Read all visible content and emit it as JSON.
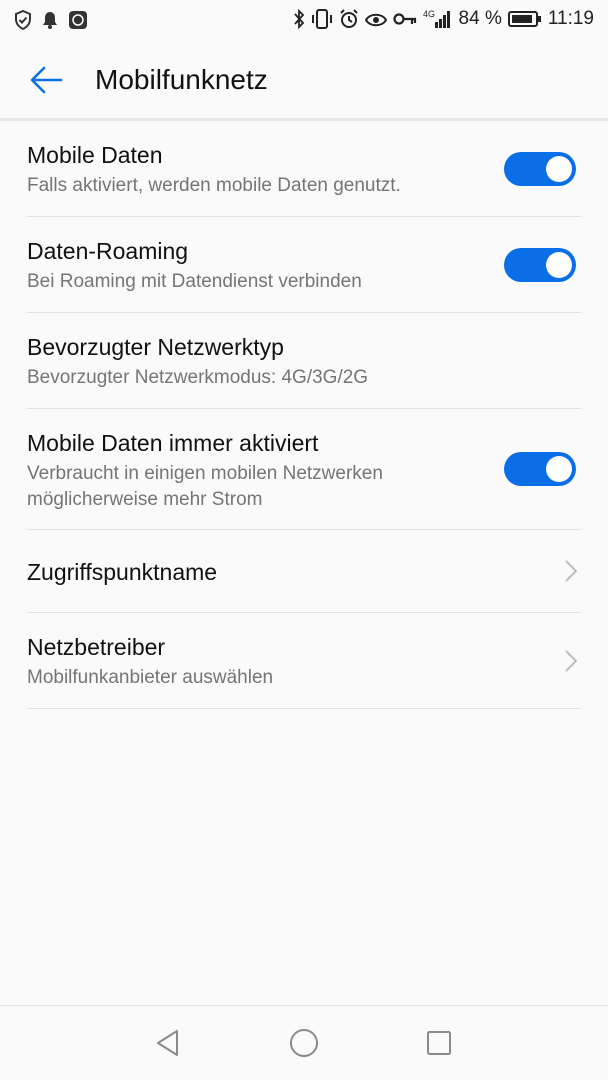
{
  "status_bar": {
    "battery": "84 %",
    "time": "11:19",
    "network": "4G",
    "icons_left": [
      "shield-icon",
      "bell-icon",
      "app-notification-icon"
    ],
    "icons_right": [
      "bluetooth-icon",
      "vibrate-icon",
      "alarm-icon",
      "eye-icon",
      "key-icon",
      "signal-icon",
      "battery-icon"
    ]
  },
  "app_bar": {
    "title": "Mobilfunknetz",
    "back_icon": "arrow-left-icon",
    "accent_color": "#0a6fe6"
  },
  "settings": [
    {
      "title": "Mobile Daten",
      "subtitle": "Falls aktiviert, werden mobile Daten genutzt.",
      "control": "toggle",
      "on": true
    },
    {
      "title": "Daten-Roaming",
      "subtitle": "Bei Roaming mit Datendienst verbinden",
      "control": "toggle",
      "on": true
    },
    {
      "title": "Bevorzugter Netzwerktyp",
      "subtitle": "Bevorzugter Netzwerkmodus: 4G/3G/2G",
      "control": "none"
    },
    {
      "title": "Mobile Daten immer aktiviert",
      "subtitle": "Verbraucht in einigen mobilen Netzwerken möglicherweise mehr Strom",
      "control": "toggle",
      "on": true
    },
    {
      "title": "Zugriffspunktname",
      "subtitle": "",
      "control": "chevron"
    },
    {
      "title": "Netzbetreiber",
      "subtitle": "Mobilfunkanbieter auswählen",
      "control": "chevron"
    }
  ],
  "nav_bar": {
    "buttons": [
      "back-triangle-icon",
      "home-circle-icon",
      "recents-square-icon"
    ]
  }
}
